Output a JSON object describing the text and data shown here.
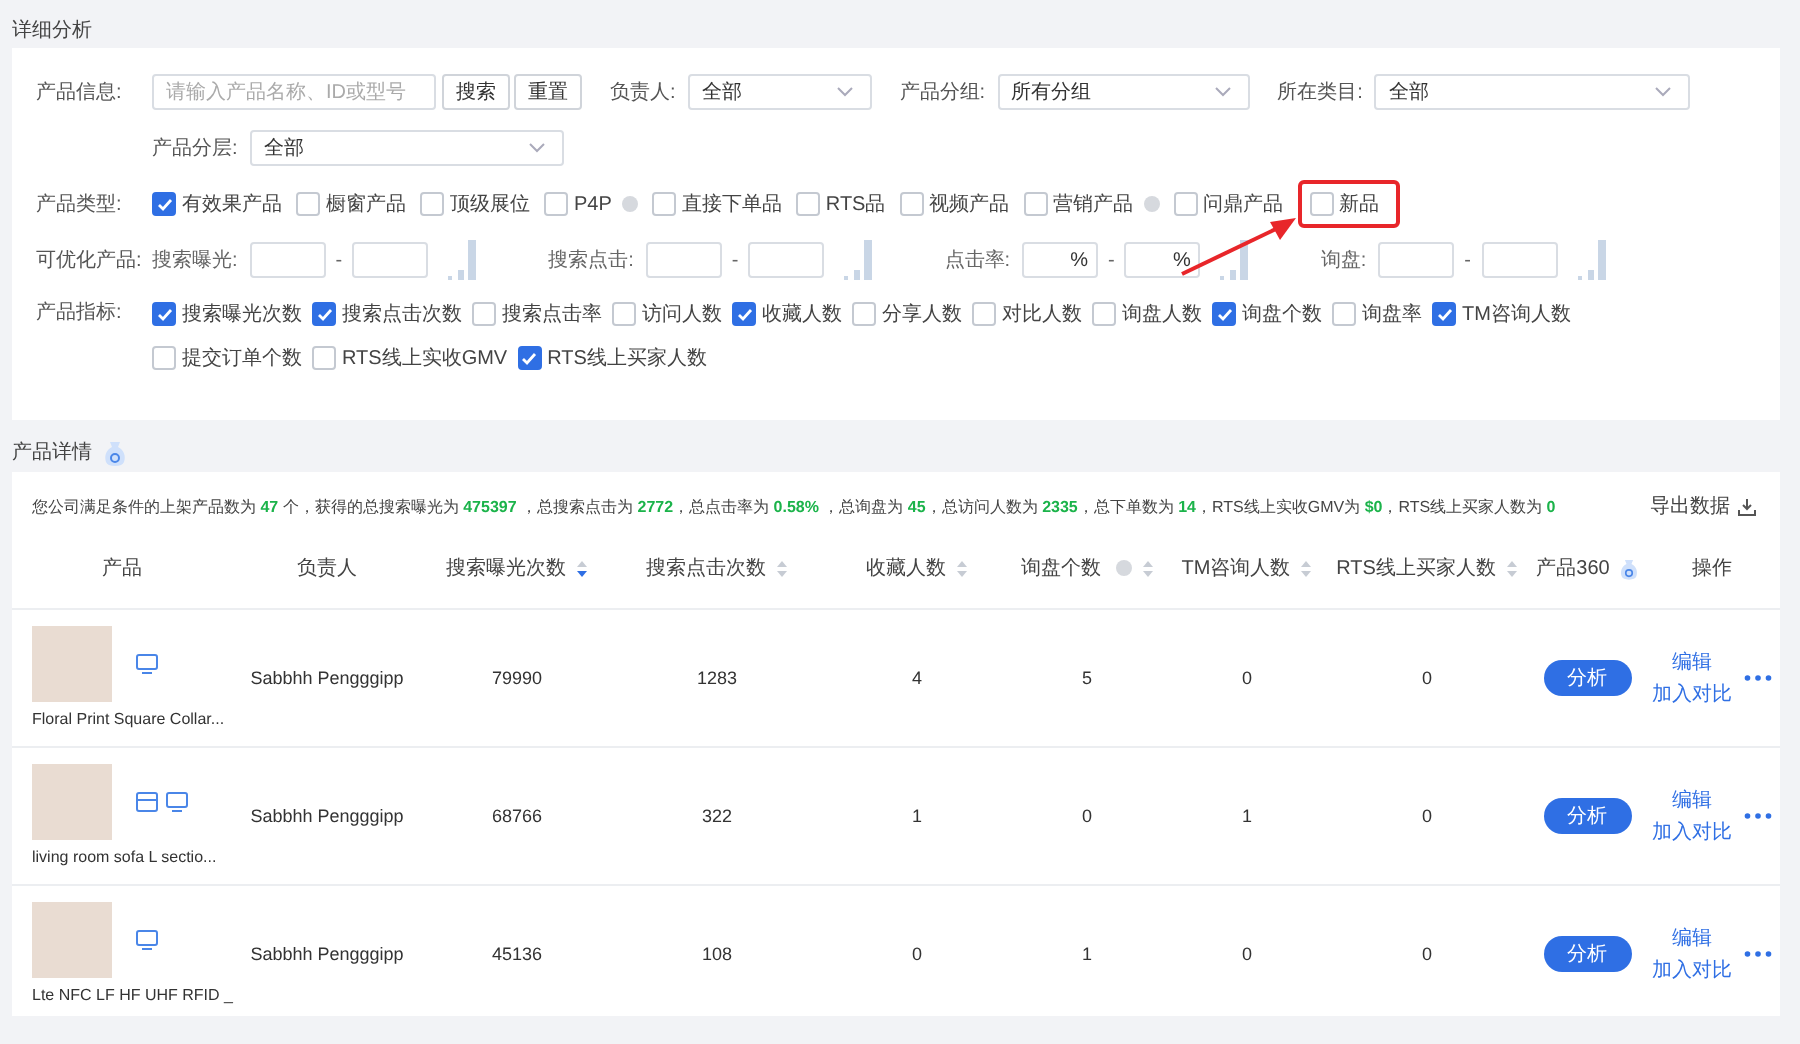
{
  "section_title": "详细分析",
  "filters": {
    "product_info": {
      "label": "产品信息:",
      "placeholder": "请输入产品名称、ID或型号",
      "buttons": [
        "搜索",
        "重置"
      ]
    },
    "selects": [
      {
        "label": "负责人:",
        "value": "全部"
      },
      {
        "label": "产品分组:",
        "value": "所有分组"
      },
      {
        "label": "所在类目:",
        "value": "全部"
      }
    ],
    "tier": {
      "label": "产品分层:",
      "value": "全部"
    },
    "types": {
      "label": "产品类型:",
      "options": [
        {
          "label": "有效果产品",
          "checked": true,
          "info": false,
          "highlighted": false
        },
        {
          "label": "橱窗产品",
          "checked": false,
          "info": false,
          "highlighted": false
        },
        {
          "label": "顶级展位",
          "checked": false,
          "info": false,
          "highlighted": false
        },
        {
          "label": "P4P",
          "checked": false,
          "info": true,
          "highlighted": false
        },
        {
          "label": "直接下单品",
          "checked": false,
          "info": false,
          "highlighted": false
        },
        {
          "label": "RTS品",
          "checked": false,
          "info": false,
          "highlighted": false
        },
        {
          "label": "视频产品",
          "checked": false,
          "info": false,
          "highlighted": false
        },
        {
          "label": "营销产品",
          "checked": false,
          "info": true,
          "highlighted": false
        },
        {
          "label": "问鼎产品",
          "checked": false,
          "info": false,
          "highlighted": false
        },
        {
          "label": "新品",
          "checked": false,
          "info": false,
          "highlighted": true
        }
      ]
    },
    "optimize": {
      "label": "可优化产品:",
      "ranges": [
        {
          "label": "搜索曝光:",
          "separator": "-"
        },
        {
          "label": "搜索点击:",
          "separator": "-"
        },
        {
          "label": "点击率:",
          "separator": "-",
          "unit": "%"
        },
        {
          "label": "询盘:",
          "separator": "-"
        }
      ]
    },
    "metrics": {
      "label": "产品指标:",
      "options": [
        {
          "label": "搜索曝光次数",
          "checked": true
        },
        {
          "label": "搜索点击次数",
          "checked": true
        },
        {
          "label": "搜索点击率",
          "checked": false
        },
        {
          "label": "访问人数",
          "checked": false
        },
        {
          "label": "收藏人数",
          "checked": true
        },
        {
          "label": "分享人数",
          "checked": false
        },
        {
          "label": "对比人数",
          "checked": false
        },
        {
          "label": "询盘人数",
          "checked": false
        },
        {
          "label": "询盘个数",
          "checked": true
        },
        {
          "label": "询盘率",
          "checked": false
        },
        {
          "label": "TM咨询人数",
          "checked": true
        },
        {
          "label": "提交订单个数",
          "checked": false
        },
        {
          "label": "RTS线上实收GMV",
          "checked": false
        },
        {
          "label": "RTS线上买家人数",
          "checked": true
        }
      ]
    }
  },
  "details": {
    "title": "产品详情",
    "summary": [
      {
        "text": "您公司满足条件的上架产品数为 ",
        "highlight": false
      },
      {
        "text": "47",
        "highlight": true
      },
      {
        "text": " 个，获得的总搜索曝光为 ",
        "highlight": false
      },
      {
        "text": "475397",
        "highlight": true
      },
      {
        "text": " ，总搜索点击为 ",
        "highlight": false
      },
      {
        "text": "2772",
        "highlight": true
      },
      {
        "text": "，总点击率为 ",
        "highlight": false
      },
      {
        "text": "0.58%",
        "highlight": true
      },
      {
        "text": " ，总询盘为 ",
        "highlight": false
      },
      {
        "text": "45",
        "highlight": true
      },
      {
        "text": "，总访问人数为 ",
        "highlight": false
      },
      {
        "text": "2335",
        "highlight": true
      },
      {
        "text": "，总下单数为 ",
        "highlight": false
      },
      {
        "text": "14",
        "highlight": true
      },
      {
        "text": "，RTS线上实收GMV为 ",
        "highlight": false
      },
      {
        "text": "$0",
        "highlight": true
      },
      {
        "text": "，RTS线上买家人数为 ",
        "highlight": false
      },
      {
        "text": "0",
        "highlight": true
      }
    ],
    "export": "导出数据",
    "columns": [
      {
        "label": "产品",
        "kind": "plain"
      },
      {
        "label": "负责人",
        "kind": "plain"
      },
      {
        "label": "搜索曝光次数",
        "kind": "sorted-desc"
      },
      {
        "label": "搜索点击次数",
        "kind": "sortable"
      },
      {
        "label": "收藏人数",
        "kind": "sortable"
      },
      {
        "label": "询盘个数",
        "kind": "info-sortable"
      },
      {
        "label": "TM咨询人数",
        "kind": "sortable"
      },
      {
        "label": "RTS线上买家人数",
        "kind": "sortable"
      },
      {
        "label": "产品360",
        "kind": "icon"
      },
      {
        "label": "操作",
        "kind": "plain"
      }
    ],
    "rows": [
      {
        "name": "Floral Print Square Collar...",
        "listing_badge": false,
        "owner": "Sabbhh Pengggipp",
        "values": [
          "79990",
          "1283",
          "4",
          "5",
          "0",
          "0"
        ],
        "action": "分析",
        "links": [
          "编辑",
          "加入对比"
        ]
      },
      {
        "name": "living room sofa L sectio...",
        "listing_badge": true,
        "owner": "Sabbhh Pengggipp",
        "values": [
          "68766",
          "322",
          "1",
          "0",
          "1",
          "0"
        ],
        "action": "分析",
        "links": [
          "编辑",
          "加入对比"
        ]
      },
      {
        "name": "Lte NFC LF HF UHF RFID _",
        "listing_badge": false,
        "owner": "Sabbhh Pengggipp",
        "values": [
          "45136",
          "108",
          "0",
          "1",
          "0",
          "0"
        ],
        "action": "分析",
        "links": [
          "编辑",
          "加入对比"
        ]
      }
    ]
  }
}
